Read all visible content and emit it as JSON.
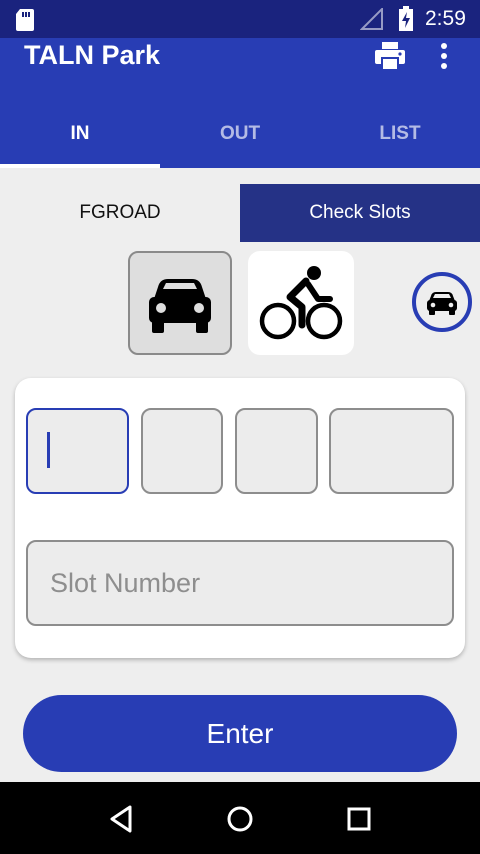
{
  "status_bar": {
    "time": "2:59",
    "icons": [
      "sd-card-icon",
      "signal-icon",
      "battery-charging-icon"
    ]
  },
  "app_bar": {
    "title": "TALN Park",
    "actions": [
      "print-icon",
      "more-vert-icon"
    ]
  },
  "tabs": [
    {
      "label": "IN",
      "selected": true
    },
    {
      "label": "OUT",
      "selected": false
    },
    {
      "label": "LIST",
      "selected": false
    }
  ],
  "location": {
    "label": "FGROAD"
  },
  "check_slots": {
    "label": "Check Slots"
  },
  "vehicle_types": [
    {
      "name": "car",
      "icon": "car-icon",
      "selected": true
    },
    {
      "name": "bike",
      "icon": "bicycle-icon",
      "selected": false
    }
  ],
  "plate_fields": [
    "",
    "",
    "",
    ""
  ],
  "slot_field": {
    "value": "",
    "placeholder": "Slot Number"
  },
  "enter_button": {
    "label": "Enter"
  },
  "nav": [
    "back-icon",
    "home-icon",
    "recents-icon"
  ],
  "colors": {
    "primary": "#283db4",
    "status_bar": "#1a237e",
    "check_slots": "#253286",
    "background": "#eeeeee"
  }
}
